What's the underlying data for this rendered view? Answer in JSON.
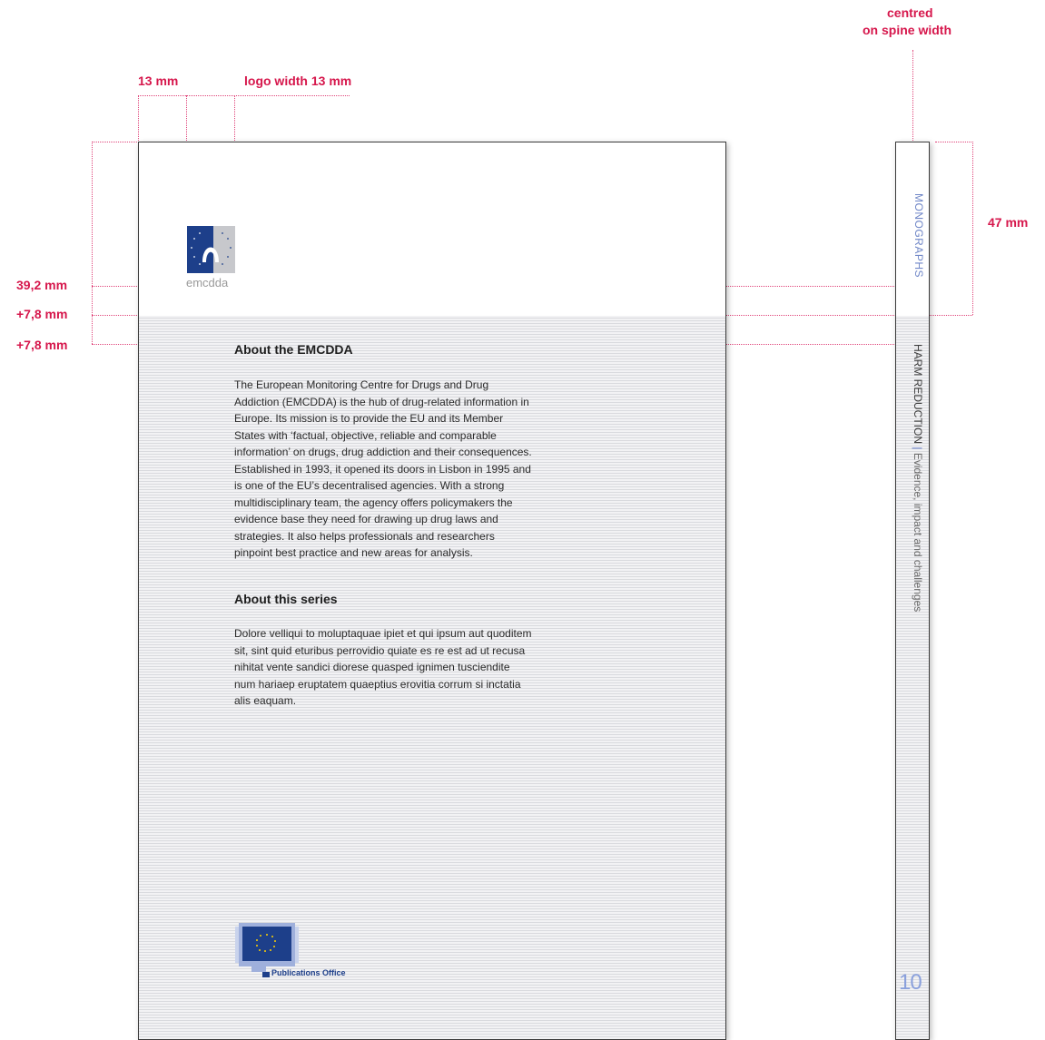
{
  "dimensions": {
    "centred_line1": "centred",
    "centred_line2": "on spine width",
    "margin_left": "13 mm",
    "logo_width": "logo width 13 mm",
    "top_39": "39,2 mm",
    "plus_1": "+7,8 mm",
    "plus_2": "+7,8 mm",
    "spine_47": "47 mm"
  },
  "cover": {
    "logo_caption": "emcdda",
    "about_title": "About the EMCDDA",
    "about_text": "The European Monitoring Centre for Drugs and Drug Addiction (EMCDDA) is the hub of drug-related information in Europe. Its mission is to provide the EU and its Member States with ‘factual, objective, reliable and comparable information’ on drugs, drug addiction and their consequences. Established in 1993, it opened its doors in Lisbon in 1995 and is one of the EU’s decentralised agencies. With a strong multidisciplinary team, the agency offers policymakers the evidence base they need for drawing up drug laws and strategies. It also helps professionals and researchers pinpoint best practice and new areas for analysis.",
    "series_title": "About this series",
    "series_text": "Dolore velliqui to moluptaquae ipiet et qui ipsum aut quoditem sit, sint quid eturibus perrovidio quiate es re est ad ut recusa nihitat vente sandici diorese quasped ignimen tusciendite num hariaep eruptatem quaeptius erovitia corrum si inctatia alis eaquam.",
    "publisher": "Publications Office"
  },
  "spine": {
    "series": "MONOGRAPHS",
    "title": "HARM REDUCTION",
    "separator": "|",
    "subtitle": "Evidence, impact and challenges",
    "number": "10"
  },
  "colors": {
    "annotation": "#d6174c",
    "eu_blue": "#1d3f8a",
    "spine_blue": "#6f86c7"
  }
}
